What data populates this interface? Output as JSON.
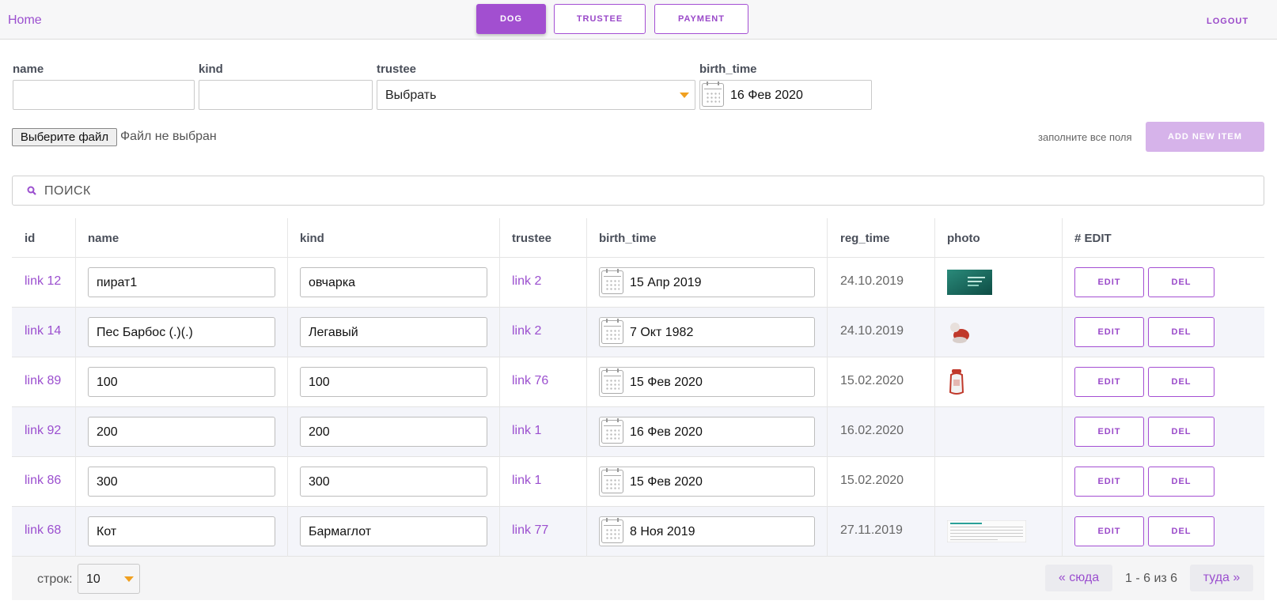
{
  "nav": {
    "home": "Home",
    "tabs": [
      {
        "label": "DOG",
        "active": true
      },
      {
        "label": "TRUSTEE",
        "active": false
      },
      {
        "label": "PAYMENT",
        "active": false
      }
    ],
    "logout": "LOGOUT"
  },
  "form": {
    "name_label": "name",
    "name_value": "",
    "kind_label": "kind",
    "kind_value": "",
    "trustee_label": "trustee",
    "trustee_value": "Выбрать",
    "birth_label": "birth_time",
    "birth_value": "16 Фев 2020",
    "file_button": "Выберите файл",
    "file_status": "Файл не выбран",
    "hint": "заполните все поля",
    "add_button": "ADD NEW ITEM"
  },
  "search": {
    "placeholder": "ПОИСК",
    "icon": "search-icon"
  },
  "table": {
    "headers": [
      "id",
      "name",
      "kind",
      "trustee",
      "birth_time",
      "reg_time",
      "photo",
      "# EDIT"
    ],
    "rows": [
      {
        "id": "link 12",
        "name": "пират1",
        "kind": "овчарка",
        "trustee": "link 2",
        "birth_time": "15 Апр 2019",
        "reg_time": "24.10.2019",
        "photo": "green-banner"
      },
      {
        "id": "link 14",
        "name": "Пес Барбос (.)(.)",
        "kind": "Легавый",
        "trustee": "link 2",
        "birth_time": "7 Окт 1982",
        "reg_time": "24.10.2019",
        "photo": "red-figure"
      },
      {
        "id": "link 89",
        "name": "100",
        "kind": "100",
        "trustee": "link 76",
        "birth_time": "15 Фев 2020",
        "reg_time": "15.02.2020",
        "photo": "red-bottle"
      },
      {
        "id": "link 92",
        "name": "200",
        "kind": "200",
        "trustee": "link 1",
        "birth_time": "16 Фев 2020",
        "reg_time": "16.02.2020",
        "photo": ""
      },
      {
        "id": "link 86",
        "name": "300",
        "kind": "300",
        "trustee": "link 1",
        "birth_time": "15 Фев 2020",
        "reg_time": "15.02.2020",
        "photo": ""
      },
      {
        "id": "link 68",
        "name": "Кот",
        "kind": "Бармаглот",
        "trustee": "link 77",
        "birth_time": "8 Ноя 2019",
        "reg_time": "27.11.2019",
        "photo": "document-scan"
      }
    ],
    "edit_label": "EDIT",
    "del_label": "DEL"
  },
  "footer": {
    "rows_label": "строк:",
    "rows_value": "10",
    "prev": "« сюда",
    "info": "1 - 6 из 6",
    "next": "туда »"
  },
  "colors": {
    "accent": "#a24fd0",
    "accent_light": "#d6b3ea",
    "caret": "#f0a020",
    "row_stripe": "#f4f5fa"
  }
}
